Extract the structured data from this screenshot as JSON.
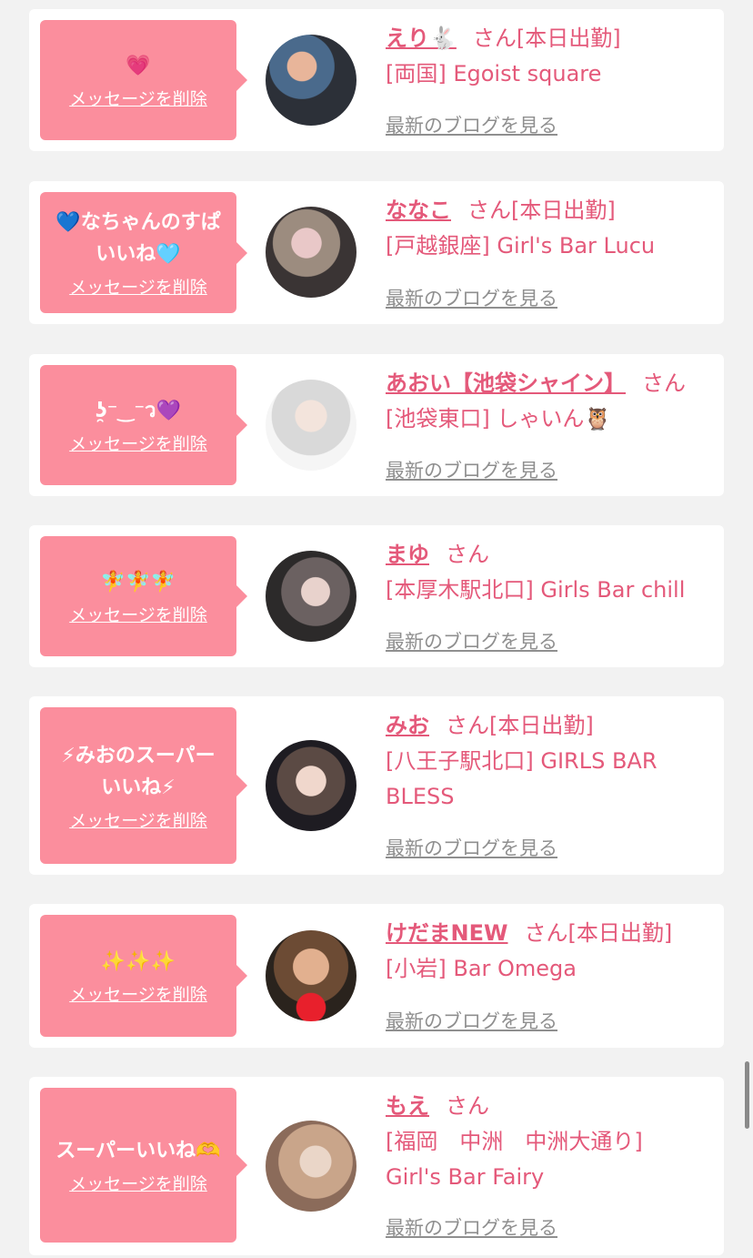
{
  "entries": [
    {
      "message": "💗",
      "delete_label": "メッセージを削除",
      "name": "えり🐇",
      "san": "さん[本日出勤]",
      "shop": "[両国] Egoist square",
      "blog_label": "最新のブログを見る"
    },
    {
      "message": "💙なちゃんのすぱ\nいいね🩵",
      "delete_label": "メッセージを削除",
      "name": "ななこ",
      "san": "さん[本日出勤]",
      "shop": "[戸越銀座] Girl's Bar Lucu",
      "blog_label": "最新のブログを見る"
    },
    {
      "message": "ʖ̯⁻‿⁻ว💜",
      "delete_label": "メッセージを削除",
      "name": "あおい【池袋シャイン】",
      "san": "さん",
      "shop": "[池袋東口] しゃいん🦉",
      "blog_label": "最新のブログを見る"
    },
    {
      "message": "🧚🧚🧚",
      "delete_label": "メッセージを削除",
      "name": "まゆ",
      "san": "さん",
      "shop": "[本厚木駅北口] Girls Bar chill",
      "blog_label": "最新のブログを見る"
    },
    {
      "message": "⚡みおのスーパー\nいいね⚡",
      "delete_label": "メッセージを削除",
      "name": "みお",
      "san": "さん[本日出勤]",
      "shop": "[八王子駅北口] GIRLS BAR BLESS",
      "blog_label": "最新のブログを見る"
    },
    {
      "message": "✨✨✨",
      "delete_label": "メッセージを削除",
      "name": "けだまNEW",
      "san": "さん[本日出勤]",
      "shop": "[小岩] Bar Omega",
      "blog_label": "最新のブログを見る"
    },
    {
      "message": "スーパーいいね🫶",
      "delete_label": "メッセージを削除",
      "name": "もえ",
      "san": "さん",
      "shop": "[福岡　中洲　中洲大通り] Girl's Bar Fairy",
      "blog_label": "最新のブログを見る"
    }
  ]
}
